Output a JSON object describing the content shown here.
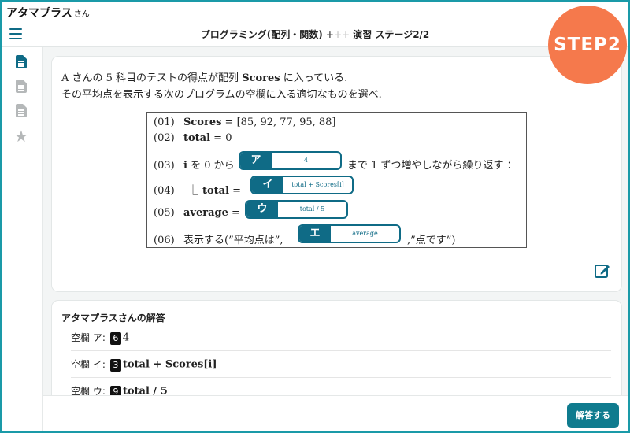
{
  "user": {
    "name": "アタマプラス",
    "suffix": "さん"
  },
  "header": {
    "title_prefix": "プログラミング(配列・関数)",
    "plus_active": "+",
    "plus_dim": "++",
    "title_suffix": "演習 ステージ2/2"
  },
  "badge": {
    "label": "STEP2"
  },
  "sidebar": {
    "icons": [
      "document-icon-active",
      "document-icon",
      "document-icon",
      "star-icon"
    ],
    "colors": {
      "active": "#0f6b86",
      "inactive": "#b5b8b9"
    }
  },
  "question": {
    "line1_a": "A さんの 5 科目のテストの得点が配列 ",
    "line1_var": "Scores",
    "line1_b": " に入っている.",
    "line2": "その平均点を表示する次のプログラムの空欄に入る適切なものを選べ."
  },
  "code": {
    "l1": {
      "num": "(01)",
      "var": "Scores",
      "rest": " = [85, 92, 77, 95, 88]"
    },
    "l2": {
      "num": "(02)",
      "var": "total",
      "rest": " = 0"
    },
    "l3": {
      "num": "(03)",
      "var": "i",
      "pre": " を 0 から",
      "post": "まで 1 ずつ増やしながら繰り返す ："
    },
    "l4": {
      "num": "(04)",
      "bar": "⎿",
      "var": "total",
      "eq": " ="
    },
    "l5": {
      "num": "(05)",
      "var": "average",
      "eq": " ="
    },
    "l6": {
      "num": "(06)",
      "pre": "表示する(”平均点は”,",
      "post": ",”点です”)"
    }
  },
  "blanks": {
    "a": {
      "tag": "ア",
      "value": "4"
    },
    "i": {
      "tag": "イ",
      "value": "total + Scores[i]"
    },
    "u": {
      "tag": "ウ",
      "value": "total / 5"
    },
    "e": {
      "tag": "エ",
      "value": "average"
    }
  },
  "answers": {
    "heading": "アタマプラスさんの解答",
    "rows": [
      {
        "label": "空欄 ア:",
        "num": "6",
        "value": "4"
      },
      {
        "label": "空欄 イ:",
        "num": "3",
        "value": "total + Scores[i]"
      },
      {
        "label": "空欄 ウ:",
        "num": "9",
        "value": "total / 5"
      }
    ]
  },
  "footer": {
    "button_label": "解答する"
  },
  "colors": {
    "accent": "#0f6b86",
    "badge": "#f5794c",
    "frame": "#1a9aa8"
  }
}
